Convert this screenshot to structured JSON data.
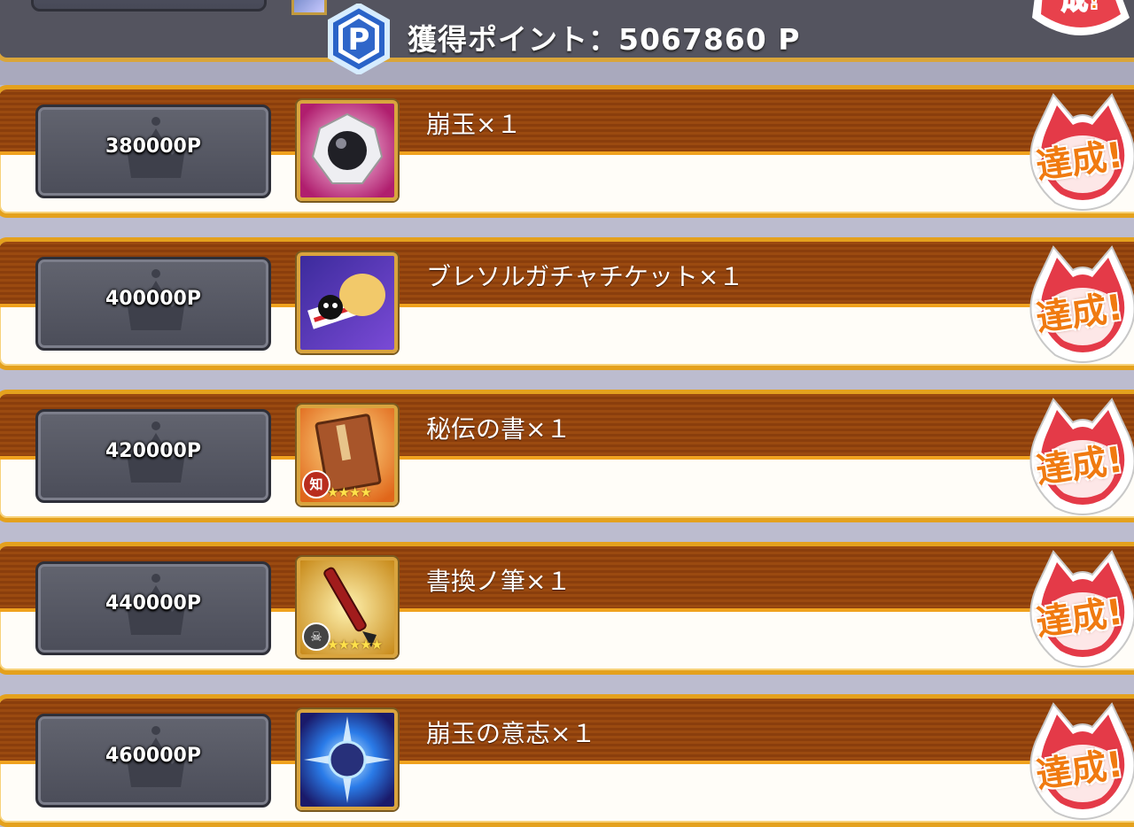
{
  "header": {
    "points_text": "獲得ポイント：5067860 P",
    "points_badge_letter": "P"
  },
  "colors": {
    "row_border": "#e4a11d",
    "row_band": "#9b4a10",
    "plate": "#4b4d59",
    "stamp_text": "#f07a10",
    "background": "#bcbccf"
  },
  "stamp_label": "達成!",
  "rewards": [
    {
      "threshold": "380000P",
      "reward": "崩玉×１",
      "icon": "hogyoku-icon"
    },
    {
      "threshold": "400000P",
      "reward": "ブレソルガチャチケット×１",
      "icon": "gacha-ticket-icon"
    },
    {
      "threshold": "420000P",
      "reward": "秘伝の書×１",
      "icon": "secret-book-icon",
      "badge": "知",
      "stars": 4
    },
    {
      "threshold": "440000P",
      "reward": "書換ノ筆×１",
      "icon": "rewrite-brush-icon",
      "stars": 5
    },
    {
      "threshold": "460000P",
      "reward": "崩玉の意志×１",
      "icon": "hogyoku-will-icon"
    }
  ]
}
